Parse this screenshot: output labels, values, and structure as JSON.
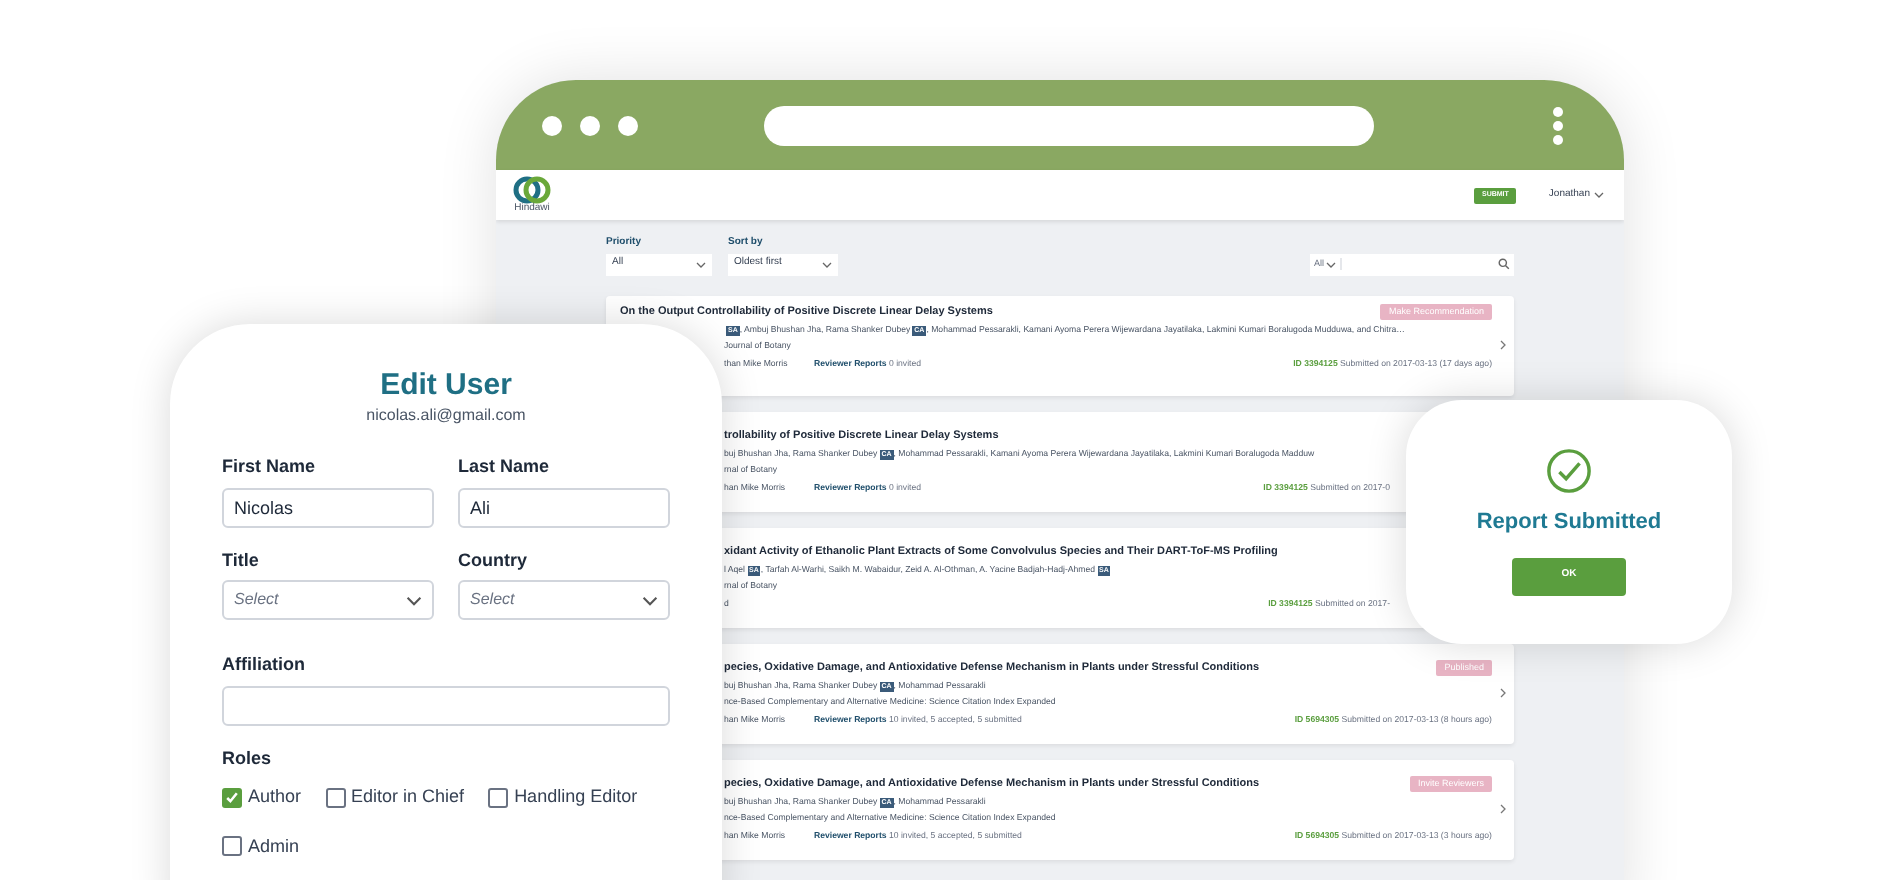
{
  "browser": {
    "header": {
      "logo_text": "Hindawi",
      "submit_button": "SUBMIT",
      "user_menu": "Jonathan"
    },
    "filters": {
      "priority": {
        "label": "Priority",
        "value": "All"
      },
      "sort_by": {
        "label": "Sort by",
        "value": "Oldest first"
      },
      "search_scope": "All"
    },
    "manuscripts": [
      {
        "title": "On the Output Controllability of Positive Discrete Linear Delay Systems",
        "authors": [
          {
            "kind": "tag",
            "text": "SA"
          },
          {
            "kind": "text",
            "text": ", Ambuj Bhushan Jha, Rama Shanker Dubey"
          },
          {
            "kind": "tag",
            "text": "CA"
          },
          {
            "kind": "text",
            "text": ", Mohammad Pessarakli, Kamani Ayoma Perera Wijewardana Jayatilaka, Lakmini Kumari Boralugoda Mudduwa, and Chitra…"
          }
        ],
        "journal": "Journal of Botany",
        "editor": "than Mike Morris",
        "reviewer_label": "Reviewer Reports",
        "reviewer_status": "0 invited",
        "id": "ID 3394125",
        "submitted": "Submitted on 2017-03-13 (17 days ago)",
        "badge": "Make Recommendation"
      },
      {
        "title": "trollability of Positive Discrete Linear Delay Systems",
        "authors": [
          {
            "kind": "text",
            "text": "buj Bhushan Jha, Rama Shanker Dubey"
          },
          {
            "kind": "tag",
            "text": "CA"
          },
          {
            "kind": "text",
            "text": ", Mohammad Pessarakli, Kamani Ayoma Perera Wijewardana Jayatilaka, Lakmini Kumari Boralugoda Madduw"
          }
        ],
        "journal": "rnal of Botany",
        "editor": "han Mike Morris",
        "reviewer_label": "Reviewer Reports",
        "reviewer_status": "0 invited",
        "id": "ID 3394125",
        "submitted": "Submitted on 2017-0"
      },
      {
        "title": "xidant Activity of Ethanolic Plant Extracts of Some Convolvulus Species and Their DART-ToF-MS Profiling",
        "authors": [
          {
            "kind": "text",
            "text": "l Aqel"
          },
          {
            "kind": "tag",
            "text": "SA"
          },
          {
            "kind": "text",
            "text": ", Tarfah Al-Warhi, Saikh M. Wabaidur, Zeid A. Al-Othman, A. Yacine Badjah-Hadj-Ahmed"
          },
          {
            "kind": "tag",
            "text": "SA"
          }
        ],
        "journal": "rnal of Botany",
        "editor": "d",
        "id": "ID 3394125",
        "submitted": "Submitted on 2017-"
      },
      {
        "title": "pecies, Oxidative Damage, and Antioxidative Defense Mechanism in Plants under Stressful Conditions",
        "authors": [
          {
            "kind": "text",
            "text": "buj Bhushan Jha, Rama Shanker Dubey"
          },
          {
            "kind": "tag",
            "text": "CA"
          },
          {
            "kind": "text",
            "text": ", Mohammad Pessarakli"
          }
        ],
        "journal": "nce-Based Complementary and Alternative Medicine: Science Citation Index Expanded",
        "editor": "han Mike Morris",
        "reviewer_label": "Reviewer Reports",
        "reviewer_status": "10 invited, 5 accepted, 5 submitted",
        "id": "ID 5694305",
        "submitted": "Submitted on 2017-03-13 (8 hours ago)",
        "badge": "Published"
      },
      {
        "title": "pecies, Oxidative Damage, and Antioxidative Defense Mechanism in Plants under Stressful Conditions",
        "authors": [
          {
            "kind": "text",
            "text": "buj Bhushan Jha, Rama Shanker Dubey"
          },
          {
            "kind": "tag",
            "text": "CA"
          },
          {
            "kind": "text",
            "text": ", Mohammad Pessarakli"
          }
        ],
        "journal": "nce-Based Complementary and Alternative Medicine: Science Citation Index Expanded",
        "editor": "han Mike Morris",
        "reviewer_label": "Reviewer Reports",
        "reviewer_status": "10 invited, 5 accepted, 5 submitted",
        "id": "ID 5694305",
        "submitted": "Submitted on 2017-03-13 (3 hours ago)",
        "badge": "Invite Reviewers"
      }
    ]
  },
  "edit_user": {
    "title": "Edit User",
    "email": "nicolas.ali@gmail.com",
    "first_name": {
      "label": "First Name",
      "value": "Nicolas"
    },
    "last_name": {
      "label": "Last Name",
      "value": "Ali"
    },
    "title_field": {
      "label": "Title",
      "placeholder": "Select"
    },
    "country": {
      "label": "Country",
      "placeholder": "Select"
    },
    "affiliation": {
      "label": "Affiliation"
    },
    "roles_label": "Roles",
    "roles": [
      {
        "label": "Author",
        "checked": true
      },
      {
        "label": "Editor in Chief",
        "checked": false
      },
      {
        "label": "Handling Editor",
        "checked": false
      },
      {
        "label": "Admin",
        "checked": false
      }
    ]
  },
  "report_dialog": {
    "title": "Report Submitted",
    "button": "OK"
  }
}
